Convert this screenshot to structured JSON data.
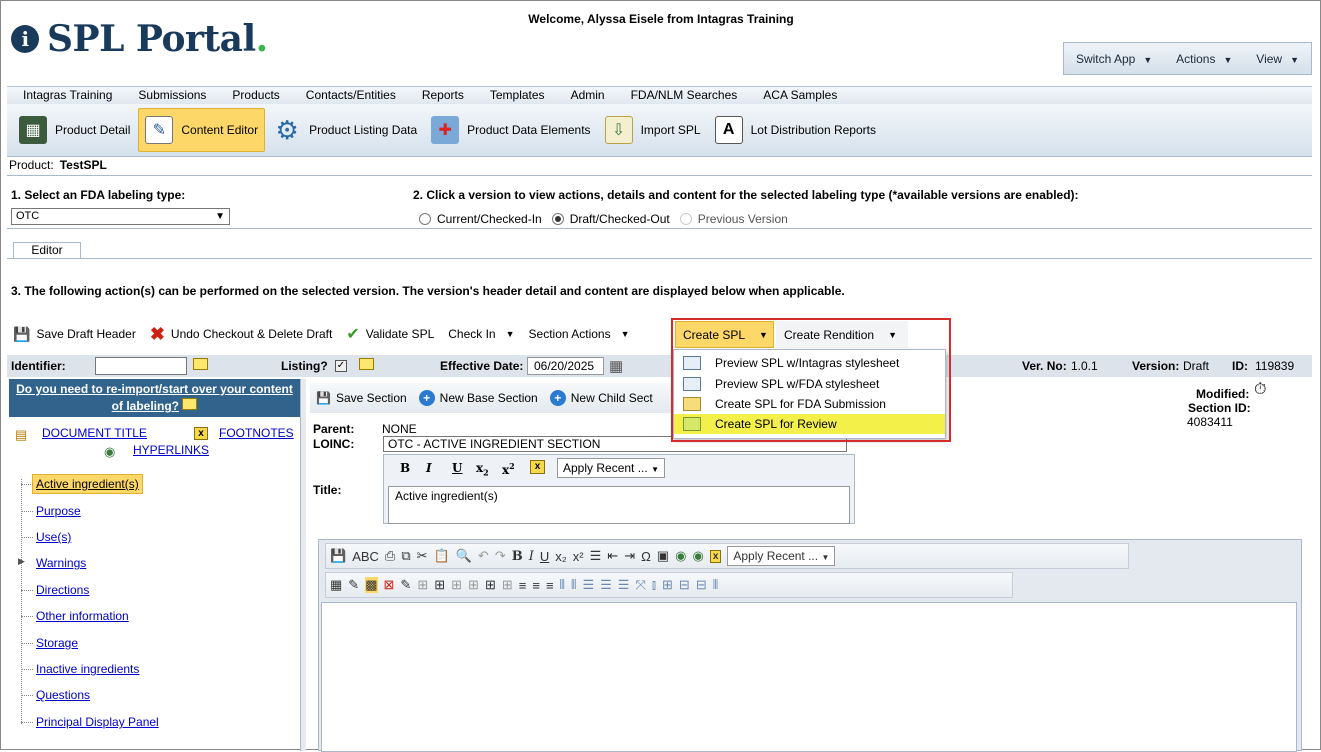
{
  "header": {
    "logo_text": "SPL Portal",
    "logo_dot": ".",
    "welcome": "Welcome, Alyssa Eisele from Intagras Training"
  },
  "appbar": {
    "switch_app": "Switch App",
    "actions": "Actions",
    "view": "View"
  },
  "nav": [
    "Intagras Training",
    "Submissions",
    "Products",
    "Contacts/Entities",
    "Reports",
    "Templates",
    "Admin",
    "FDA/NLM Searches",
    "ACA Samples"
  ],
  "toolbar": [
    {
      "label": "Product Detail",
      "icon": "product-detail-icon",
      "active": false
    },
    {
      "label": "Content Editor",
      "icon": "content-editor-icon",
      "active": true
    },
    {
      "label": "Product Listing Data",
      "icon": "gear-icon",
      "active": false
    },
    {
      "label": "Product Data Elements",
      "icon": "medical-kit-icon",
      "active": false
    },
    {
      "label": "Import SPL",
      "icon": "import-icon",
      "active": false
    },
    {
      "label": "Lot Distribution Reports",
      "icon": "document-icon",
      "active": false
    }
  ],
  "product": {
    "label": "Product:",
    "name": "TestSPL"
  },
  "step1": {
    "label": "1. Select an FDA labeling type:",
    "value": "OTC"
  },
  "step2": {
    "label": "2. Click a version to view actions, details and content for the selected labeling type (*available versions are enabled):",
    "options": [
      "Current/Checked-In",
      "Draft/Checked-Out",
      "Previous Version"
    ]
  },
  "tab": "Editor",
  "step3": "3. The following action(s) can be performed on the selected version. The version's header detail and content are displayed below when applicable.",
  "actions": {
    "save_draft": "Save Draft Header",
    "undo": "Undo Checkout & Delete Draft",
    "validate": "Validate SPL",
    "check_in": "Check In",
    "section_actions": "Section Actions",
    "create_spl": "Create SPL",
    "create_rendition": "Create Rendition"
  },
  "create_spl_menu": [
    "Preview SPL w/Intagras stylesheet",
    "Preview SPL w/FDA stylesheet",
    "Create SPL for FDA Submission",
    "Create SPL for Review"
  ],
  "header_row": {
    "identifier": "Identifier:",
    "listing": "Listing?",
    "effective_date_label": "Effective Date:",
    "effective_date": "06/20/2025",
    "ver_no_label": "Ver. No:",
    "ver_no": "1.0.1",
    "version_label": "Version:",
    "version": "Draft",
    "id_label": "ID:",
    "id": "119839"
  },
  "left": {
    "banner": "Do you need to re-import/start over your content of labeling?",
    "document_title": "DOCUMENT TITLE",
    "footnotes": "FOOTNOTES",
    "hyperlinks": "HYPERLINKS",
    "sections": [
      "Active ingredient(s)",
      "Purpose",
      "Use(s)",
      "Warnings",
      "Directions",
      "Other information",
      "Storage",
      "Inactive ingredients",
      "Questions",
      "Principal Display Panel"
    ]
  },
  "section": {
    "save": "Save Section",
    "new_base": "New Base Section",
    "new_child": "New Child Sect",
    "parent_label": "Parent:",
    "parent": "NONE",
    "loinc_label": "LOINC:",
    "loinc": "OTC - ACTIVE INGREDIENT SECTION",
    "title_label": "Title:",
    "title": "Active ingredient(s)",
    "apply_recent": "Apply Recent ...",
    "modified": "Modified:",
    "section_id_label": "Section ID:",
    "section_id": "4083411"
  },
  "colors": {
    "brand": "#1a3a5c",
    "accent": "#fdd868",
    "highlight": "#f3f04a",
    "banner": "#31638c",
    "callout": "#d62b2b"
  }
}
